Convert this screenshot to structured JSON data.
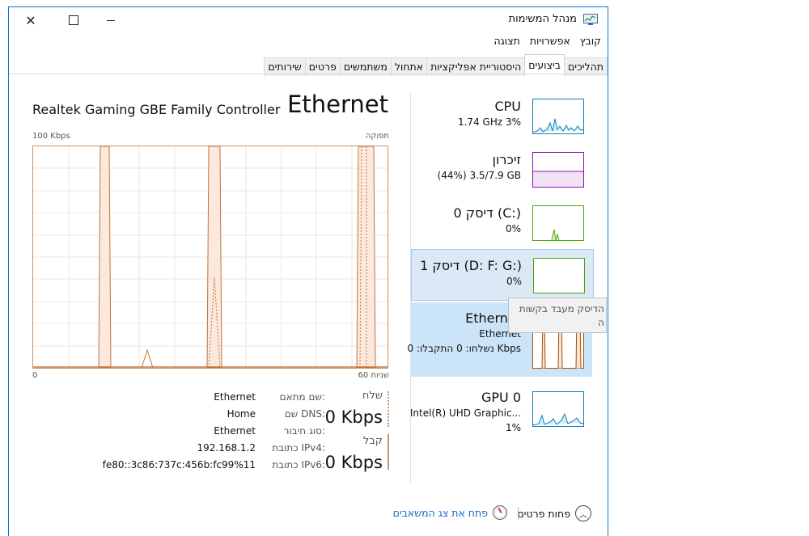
{
  "window": {
    "title": "מנהל המשימות",
    "close_glyph": "✕",
    "maximize_glyph": "☐",
    "minimize_glyph": "—"
  },
  "menu": [
    "קובץ",
    "אפשרויות",
    "תצוגה"
  ],
  "tabs": [
    {
      "label": "תהליכים",
      "active": false
    },
    {
      "label": "ביצועים",
      "active": true
    },
    {
      "label": "היסטוריית אפליקציות",
      "active": false
    },
    {
      "label": "אתחול",
      "active": false
    },
    {
      "label": "משתמשים",
      "active": false
    },
    {
      "label": "פרטים",
      "active": false
    },
    {
      "label": "שירותים",
      "active": false
    }
  ],
  "detail": {
    "title": "Ethernet",
    "device": "Realtek Gaming GBE Family Controller",
    "axis_max": "100 Kbps",
    "axis_label": "תפוקה",
    "axis_min": "0",
    "axis_time": "60 שניות",
    "send_label": "שלח",
    "send_value": "0 Kbps",
    "recv_label": "קבל",
    "recv_value": "0 Kbps",
    "info": [
      {
        "label": "שם מתאם:",
        "value": "Ethernet"
      },
      {
        "label": "שם DNS:",
        "value": "Home"
      },
      {
        "label": "סוג חיבור:",
        "value": "Ethernet"
      },
      {
        "label": "כתובת IPv4:",
        "value": "192.168.1.2"
      },
      {
        "label": "כתובת IPv6:",
        "value": "fe80::3c86:737c:456b:fc99%11"
      }
    ]
  },
  "resources": [
    {
      "title": "CPU",
      "sub": "1.74 GHz  3%",
      "color": "#117dbb"
    },
    {
      "title": "זיכרון",
      "sub": "(44%) 3.5/7.9 GB",
      "color": "#8b12ae"
    },
    {
      "title": "דיסק 0 (C:)",
      "sub": "0%",
      "color": "#4da60c"
    },
    {
      "title": "דיסק 1 (D: F: G:)",
      "sub": "0%",
      "color": "#4da60c"
    },
    {
      "title": "Ethernet",
      "sub": "Ethernet",
      "sub2": "נשלחו: 0 התקבלו: 0 Kbps",
      "color": "#a74f01"
    },
    {
      "title": "GPU 0",
      "sub": "Intel(R) UHD Graphic...",
      "sub2": "1%",
      "color": "#117dbb"
    }
  ],
  "tooltip": {
    "line1": "הדיסק מעבד בקשות",
    "line2": "ה"
  },
  "footer": {
    "less_details": "פחות פרטים",
    "open_monitor": "פתח את צג המשאבים"
  }
}
